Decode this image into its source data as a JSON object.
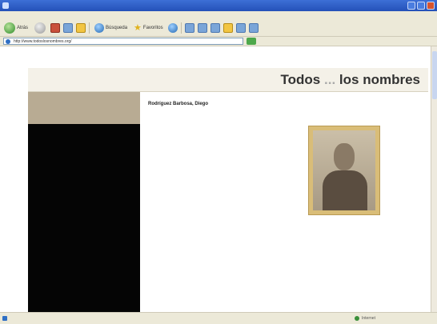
{
  "window": {
    "title": ""
  },
  "menu": [
    "",
    "",
    "",
    "",
    "",
    ""
  ],
  "toolbar": {
    "back_label": "Atrás",
    "search_label": "Búsqueda",
    "favorites_label": "Favoritos"
  },
  "address": {
    "url": "http://www.todoslosnombres.org/"
  },
  "site": {
    "title_left": "Todos",
    "title_middle": "...",
    "title_right": "los nombres",
    "menu": [
      "",
      "",
      "",
      "",
      "",
      "",
      ""
    ]
  },
  "person": {
    "name": "Rodríguez Barbosa, Diego",
    "details": [
      {
        "text": "",
        "style": "b"
      },
      {
        "text": "",
        "style": "b"
      },
      {
        "text": "",
        "style": "b"
      },
      {
        "text": "",
        "style": "sub"
      },
      {
        "text": "",
        "style": "sub"
      },
      {
        "text": "",
        "style": "b"
      },
      {
        "text": "",
        "style": "sub"
      },
      {
        "text": "",
        "style": "sub"
      },
      {
        "text": "",
        "style": "sub"
      },
      {
        "text": "",
        "style": "b"
      },
      {
        "text": "",
        "style": "sub"
      },
      {
        "text": "",
        "style": "sub"
      },
      {
        "text": "",
        "style": "b"
      },
      {
        "text": "",
        "style": "b"
      },
      {
        "text": "",
        "style": "sub"
      },
      {
        "text": "",
        "style": "sub"
      },
      {
        "text": "",
        "style": "sub"
      },
      {
        "text": "",
        "style": "b"
      },
      {
        "text": "",
        "style": "b"
      },
      {
        "text": "",
        "style": "b"
      },
      {
        "text": "",
        "style": "b"
      },
      {
        "text": "",
        "style": "b"
      },
      {
        "text": "",
        "style": "b"
      },
      {
        "text": "",
        "style": "b"
      }
    ]
  },
  "status": {
    "text": "",
    "zone": "Internet"
  },
  "colors": {
    "menu_bg": "#b8ab93",
    "sidebar_dark": "#050505",
    "photo_frame": "#d9bd78",
    "chrome": "#ece9d8"
  }
}
